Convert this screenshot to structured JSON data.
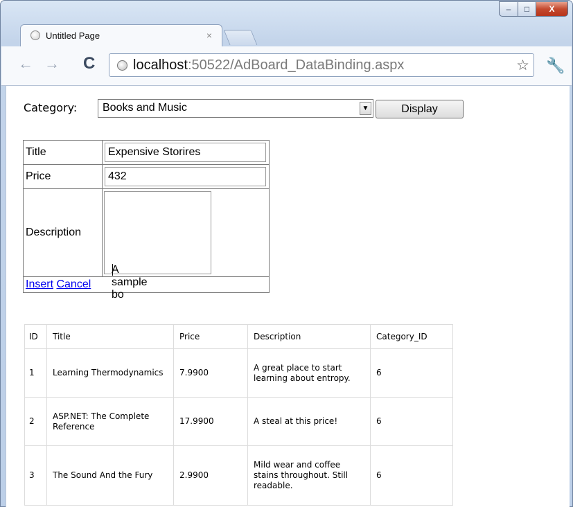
{
  "browser": {
    "tab_title": "Untitled Page",
    "tab_close": "×",
    "url_host": "localhost",
    "url_rest": ":50522/AdBoard_DataBinding.aspx",
    "window_controls": {
      "minimize": "–",
      "maximize": "□",
      "close": "X"
    }
  },
  "page": {
    "category_label": "Category:",
    "category_selected": "Books and Music",
    "display_button": "Display",
    "form": {
      "title_label": "Title",
      "title_value": "Expensive Storires",
      "price_label": "Price",
      "price_value": "432",
      "description_label": "Description",
      "description_value": "A sample bo",
      "insert_link": "Insert",
      "cancel_link": "Cancel"
    },
    "grid": {
      "headers": [
        "ID",
        "Title",
        "Price",
        "Description",
        "Category_ID"
      ],
      "rows": [
        {
          "id": "1",
          "title": "Learning Thermodynamics",
          "price": "7.9900",
          "description": "A great place to start learning about entropy.",
          "category_id": "6"
        },
        {
          "id": "2",
          "title": "ASP.NET: The Complete Reference",
          "price": "17.9900",
          "description": "A steal at this price!",
          "category_id": "6"
        },
        {
          "id": "3",
          "title": "The Sound And the Fury",
          "price": "2.9900",
          "description": "Mild wear and coffee stains throughout. Still readable.",
          "category_id": "6"
        }
      ]
    }
  }
}
